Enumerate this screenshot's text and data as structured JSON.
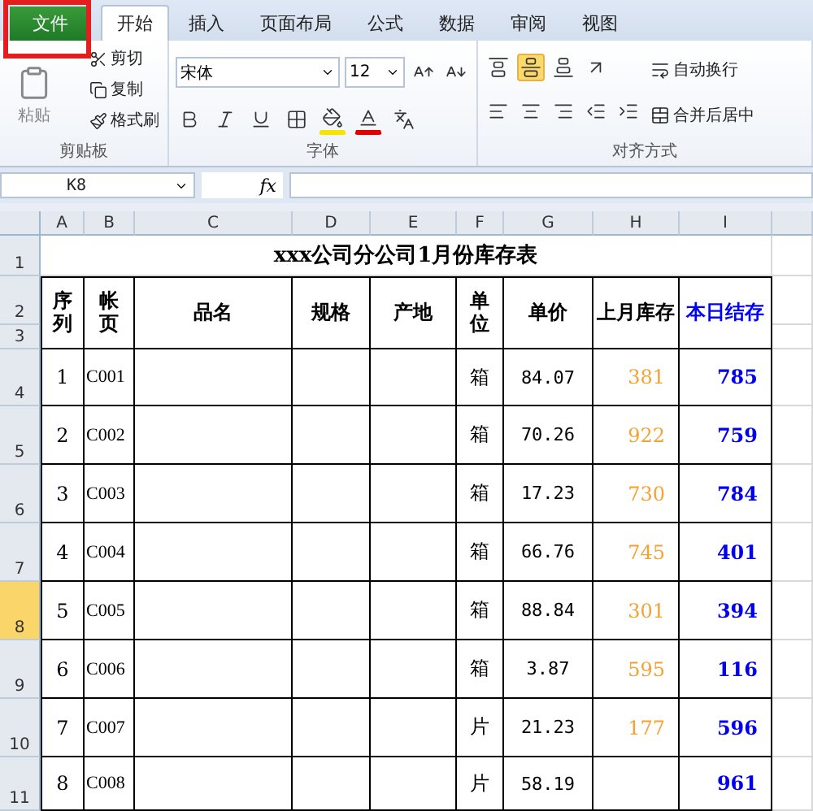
{
  "ribbon_tabs": [
    {
      "label": "文件",
      "selected": false,
      "kind": "file"
    },
    {
      "label": "开始",
      "selected": true,
      "kind": "tab"
    },
    {
      "label": "插入",
      "selected": false,
      "kind": "tab"
    },
    {
      "label": "页面布局",
      "selected": false,
      "kind": "tab"
    },
    {
      "label": "公式",
      "selected": false,
      "kind": "tab"
    },
    {
      "label": "数据",
      "selected": false,
      "kind": "tab"
    },
    {
      "label": "审阅",
      "selected": false,
      "kind": "tab"
    },
    {
      "label": "视图",
      "selected": false,
      "kind": "tab"
    }
  ],
  "clipboard": {
    "paste": "粘贴",
    "cut": "剪切",
    "copy": "复制",
    "format_painter": "格式刷",
    "label": "剪贴板"
  },
  "font": {
    "name": "宋体",
    "size": "12",
    "label": "字体"
  },
  "alignment": {
    "vertical": [
      {
        "kind": "top",
        "selected": false
      },
      {
        "kind": "middle",
        "selected": true
      },
      {
        "kind": "bottom",
        "selected": false
      }
    ],
    "wrap_text": "自动换行",
    "merge_center": "合并后居中",
    "label": "对齐方式"
  },
  "name_box": "K8",
  "formula_button": "fx",
  "columns": [
    "A",
    "B",
    "C",
    "D",
    "E",
    "F",
    "G",
    "H",
    "I"
  ],
  "row_numbers": [
    {
      "label": "1",
      "selected": false
    },
    {
      "label": "2",
      "selected": false
    },
    {
      "label": "3",
      "selected": false
    },
    {
      "label": "4",
      "selected": false
    },
    {
      "label": "5",
      "selected": false
    },
    {
      "label": "6",
      "selected": false
    },
    {
      "label": "7",
      "selected": false
    },
    {
      "label": "8",
      "selected": true
    },
    {
      "label": "9",
      "selected": false
    },
    {
      "label": "10",
      "selected": false
    },
    {
      "label": "11",
      "selected": false
    }
  ],
  "sheet_title": "xxx公司分公司1月份库存表",
  "headers": [
    {
      "text": "序列",
      "color": "#000000"
    },
    {
      "text": "帐页",
      "color": "#000000"
    },
    {
      "text": "品名",
      "color": "#000000"
    },
    {
      "text": "规格",
      "color": "#000000"
    },
    {
      "text": "产地",
      "color": "#000000"
    },
    {
      "text": "单位",
      "color": "#000000"
    },
    {
      "text": "单价",
      "color": "#000000"
    },
    {
      "text": "上月库存",
      "color": "#000000"
    },
    {
      "text": "本日结存",
      "color": "#0000ff"
    }
  ],
  "rows": [
    {
      "seq": "1",
      "account": "C001",
      "unit": "箱",
      "price": "84.07",
      "last_month": "381",
      "today": "785"
    },
    {
      "seq": "2",
      "account": "C002",
      "unit": "箱",
      "price": "70.26",
      "last_month": "922",
      "today": "759"
    },
    {
      "seq": "3",
      "account": "C003",
      "unit": "箱",
      "price": "17.23",
      "last_month": "730",
      "today": "784"
    },
    {
      "seq": "4",
      "account": "C004",
      "unit": "箱",
      "price": "66.76",
      "last_month": "745",
      "today": "401"
    },
    {
      "seq": "5",
      "account": "C005",
      "unit": "箱",
      "price": "88.84",
      "last_month": "301",
      "today": "394"
    },
    {
      "seq": "6",
      "account": "C006",
      "unit": "箱",
      "price": "3.87",
      "last_month": "595",
      "today": "116"
    },
    {
      "seq": "7",
      "account": "C007",
      "unit": "片",
      "price": "21.23",
      "last_month": "177",
      "today": "596"
    },
    {
      "seq": "8",
      "account": "C008",
      "unit": "片",
      "price": "58.19",
      "today": "961"
    }
  ]
}
